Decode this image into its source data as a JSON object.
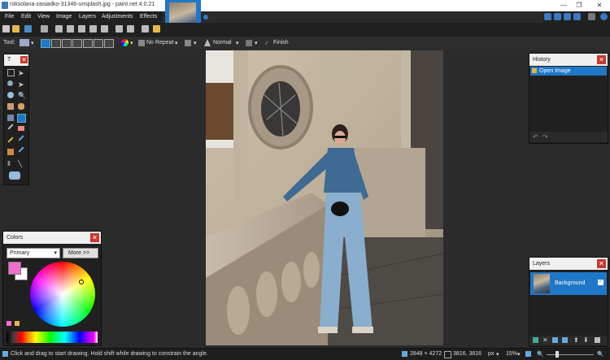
{
  "window": {
    "title": "roksolana-zasiadko-31346-unsplash.jpg - paint.net 4.0.21",
    "minimize": "—",
    "maximize": "❐",
    "close": "✕"
  },
  "menu": [
    "File",
    "Edit",
    "View",
    "Image",
    "Layers",
    "Adjustments",
    "Effects"
  ],
  "toolbar": {
    "tool_label": "Tool:",
    "repeat_mode": "No Repeat",
    "blend_mode": "Normal",
    "finish_label": "Finish"
  },
  "tools_panel": {
    "title": "T"
  },
  "history": {
    "title": "History",
    "items": [
      "Open Image"
    ]
  },
  "colors": {
    "title": "Colors",
    "mode": "Primary",
    "more_label": "More >>",
    "primary": "#f06fd0",
    "secondary": "#ffffff"
  },
  "layers": {
    "title": "Layers",
    "items": [
      {
        "name": "Background",
        "checked": true
      }
    ]
  },
  "status": {
    "hint": "Click and drag to start drawing. Hold shift while drawing to constrain the angle.",
    "image_size": "2848 × 4272",
    "cursor_pos": "3816, 3816",
    "unit": "px",
    "zoom": "15%"
  },
  "accent": "#1f77c7",
  "close_color": "#c8372d"
}
